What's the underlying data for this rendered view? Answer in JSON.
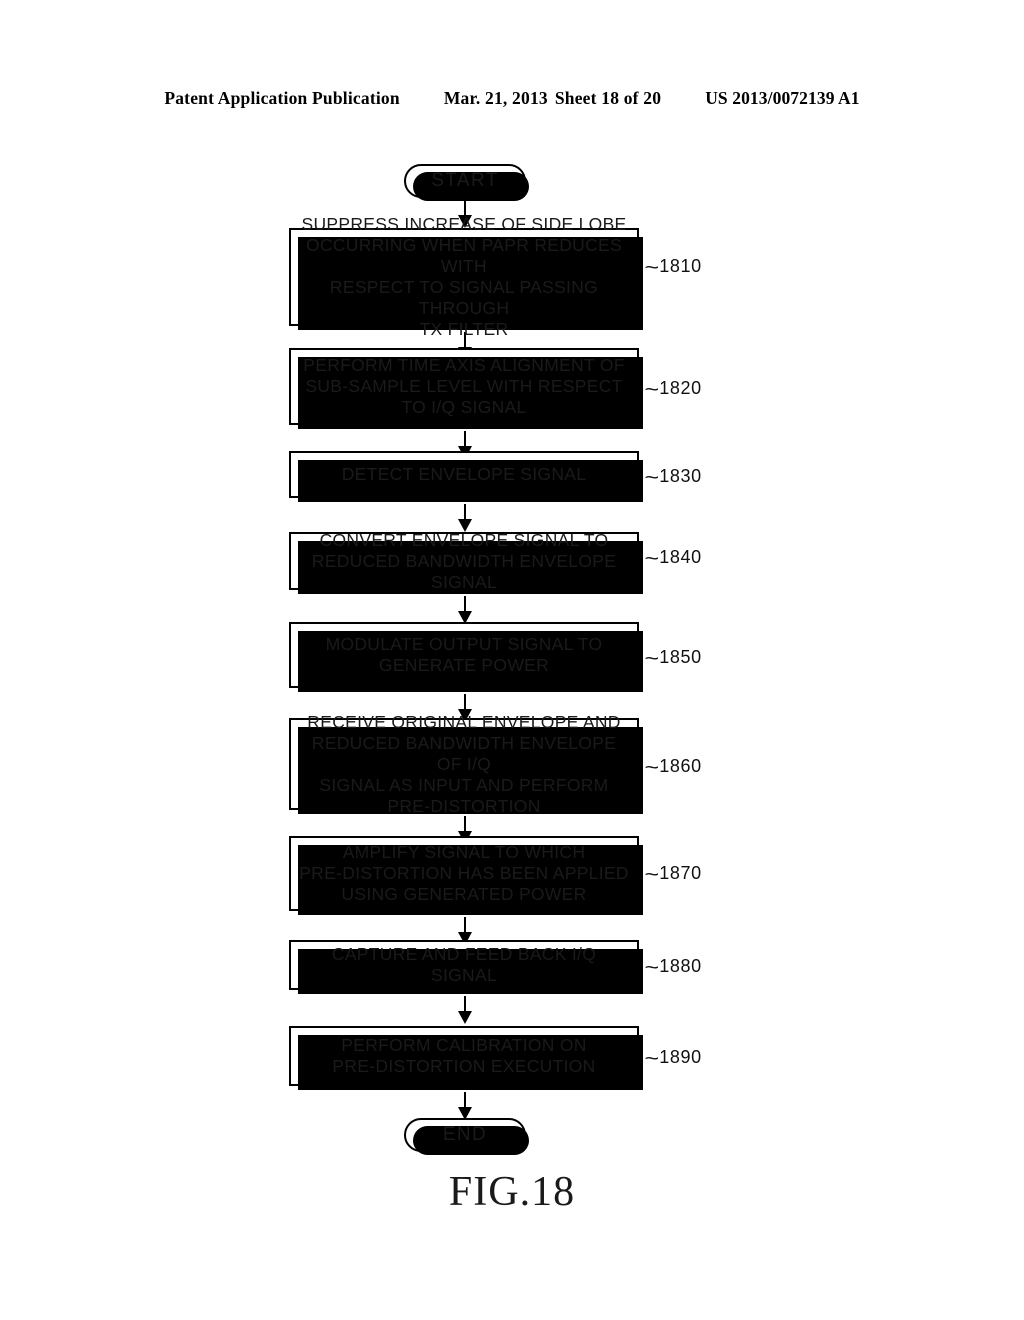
{
  "header": {
    "publication": "Patent Application Publication",
    "date": "Mar. 21, 2013",
    "sheet": "Sheet 18 of 20",
    "document_number": "US 2013/0072139 A1"
  },
  "figure": {
    "caption": "FIG.18",
    "start_label": "START",
    "end_label": "END",
    "lead_glyph": "~"
  },
  "steps": [
    {
      "ref": "1810",
      "text": "SUPPRESS INCREASE OF SIDE LOBE\nOCCURRING WHEN PAPR REDUCES WITH\nRESPECT TO SIGNAL PASSING THROUGH\nTX FILTER"
    },
    {
      "ref": "1820",
      "text": "PERFORM TIME AXIS ALIGNMENT OF\nSUB-SAMPLE LEVEL WITH RESPECT\nTO I/Q SIGNAL"
    },
    {
      "ref": "1830",
      "text": "DETECT ENVELOPE SIGNAL"
    },
    {
      "ref": "1840",
      "text": "CONVERT ENVELOPE SIGNAL TO\nREDUCED BANDWIDTH ENVELOPE SIGNAL"
    },
    {
      "ref": "1850",
      "text": "MODULATE OUTPUT SIGNAL TO\nGENERATE POWER"
    },
    {
      "ref": "1860",
      "text": "RECEIVE ORIGINAL ENVELOPE AND\nREDUCED BANDWIDTH ENVELOPE OF I/Q\nSIGNAL AS INPUT AND PERFORM\nPRE-DISTORTION"
    },
    {
      "ref": "1870",
      "text": "AMPLIFY SIGNAL TO WHICH\nPRE-DISTORTION HAS BEEN APPLIED\nUSING GENERATED POWER"
    },
    {
      "ref": "1880",
      "text": "CAPTURE AND FEED BACK I/Q SIGNAL"
    },
    {
      "ref": "1890",
      "text": "PERFORM CALIBRATION ON\nPRE-DISTORTION EXECUTION"
    }
  ]
}
